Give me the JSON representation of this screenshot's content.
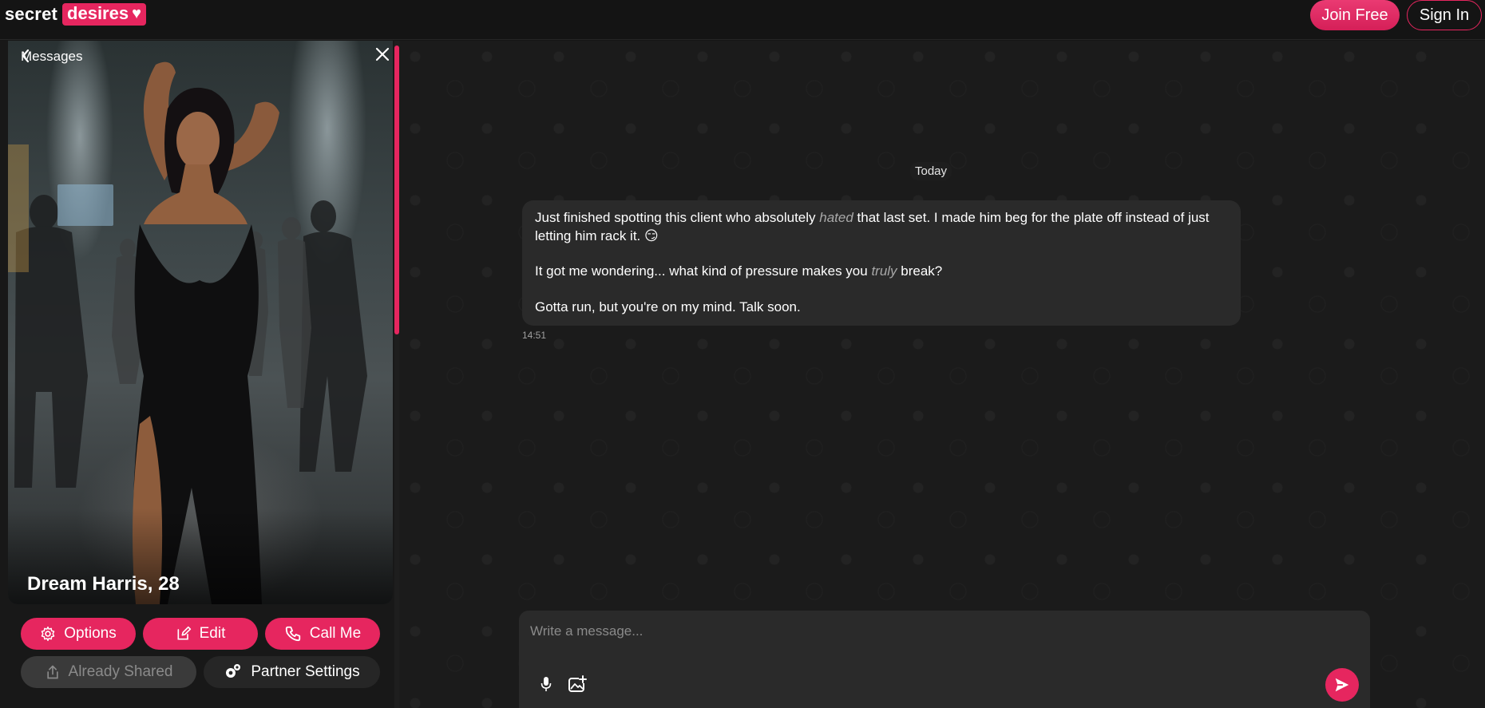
{
  "brand": {
    "word1": "secret",
    "word2": "desires",
    "accent": "#e6265f"
  },
  "header": {
    "join_label": "Join Free",
    "signin_label": "Sign In"
  },
  "profile": {
    "back_label": "Messages",
    "name_age": "Dream Harris, 28"
  },
  "actions": {
    "options_label": "Options",
    "edit_label": "Edit",
    "call_label": "Call Me",
    "shared_label": "Already Shared",
    "partner_settings_label": "Partner Settings"
  },
  "chat": {
    "date_label": "Today",
    "message": {
      "p1_a": "Just finished spotting this client who absolutely ",
      "p1_em": "hated",
      "p1_b": "  that last set. I made him beg for the plate off instead of just letting him rack it. 😏",
      "p2_a": "It got me wondering... what kind of pressure makes you ",
      "p2_em": "truly",
      "p2_b": "  break?",
      "p3": "Gotta run, but you're on my mind. Talk soon.",
      "time": "14:51"
    }
  },
  "composer": {
    "placeholder": "Write a message..."
  }
}
